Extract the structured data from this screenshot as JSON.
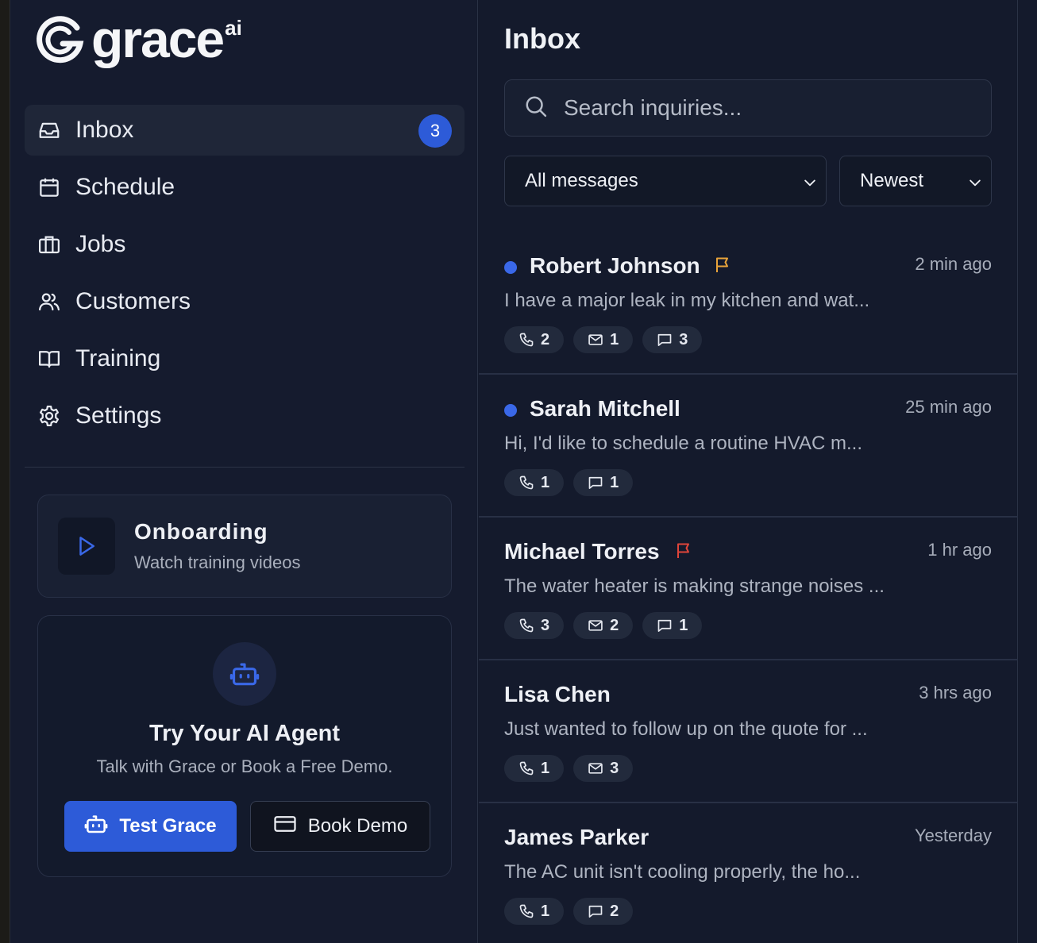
{
  "brand": {
    "name": "grace",
    "suffix": "ai"
  },
  "nav": [
    {
      "label": "Inbox",
      "icon": "inbox-icon",
      "active": true,
      "badge": "3"
    },
    {
      "label": "Schedule",
      "icon": "calendar-icon"
    },
    {
      "label": "Jobs",
      "icon": "briefcase-icon"
    },
    {
      "label": "Customers",
      "icon": "users-icon"
    },
    {
      "label": "Training",
      "icon": "book-open-icon"
    },
    {
      "label": "Settings",
      "icon": "gear-icon"
    }
  ],
  "onboarding": {
    "title": "Onboarding",
    "subtitle": "Watch training videos"
  },
  "agent": {
    "title": "Try Your AI Agent",
    "subtitle": "Talk with Grace or Book a Free Demo.",
    "test_label": "Test Grace",
    "demo_label": "Book Demo"
  },
  "inbox": {
    "title": "Inbox",
    "search_placeholder": "Search inquiries...",
    "filter_value": "All messages",
    "sort_value": "Newest"
  },
  "colors": {
    "accent": "#2d5bd8",
    "unread_dot": "#3a68e8",
    "flag_amber": "#e8a33a",
    "flag_red": "#e0453a"
  },
  "messages": [
    {
      "name": "Robert Johnson",
      "unread": true,
      "flag": "amber",
      "time": "2 min ago",
      "preview": "I have a major leak in my kitchen and wat...",
      "counts": {
        "calls": "2",
        "emails": "1",
        "chats": "3"
      }
    },
    {
      "name": "Sarah Mitchell",
      "unread": true,
      "flag": "",
      "time": "25 min ago",
      "preview": "Hi, I'd like to schedule a routine HVAC m...",
      "counts": {
        "calls": "1",
        "chats": "1"
      }
    },
    {
      "name": "Michael Torres",
      "unread": false,
      "flag": "red",
      "time": "1 hr ago",
      "preview": "The water heater is making strange noises ...",
      "counts": {
        "calls": "3",
        "emails": "2",
        "chats": "1"
      }
    },
    {
      "name": "Lisa Chen",
      "unread": false,
      "flag": "",
      "time": "3 hrs ago",
      "preview": "Just wanted to follow up on the quote for ...",
      "counts": {
        "calls": "1",
        "emails": "3"
      }
    },
    {
      "name": "James Parker",
      "unread": false,
      "flag": "",
      "time": "Yesterday",
      "preview": "The AC unit isn't cooling properly, the ho...",
      "counts": {
        "calls": "1",
        "chats": "2"
      }
    }
  ]
}
